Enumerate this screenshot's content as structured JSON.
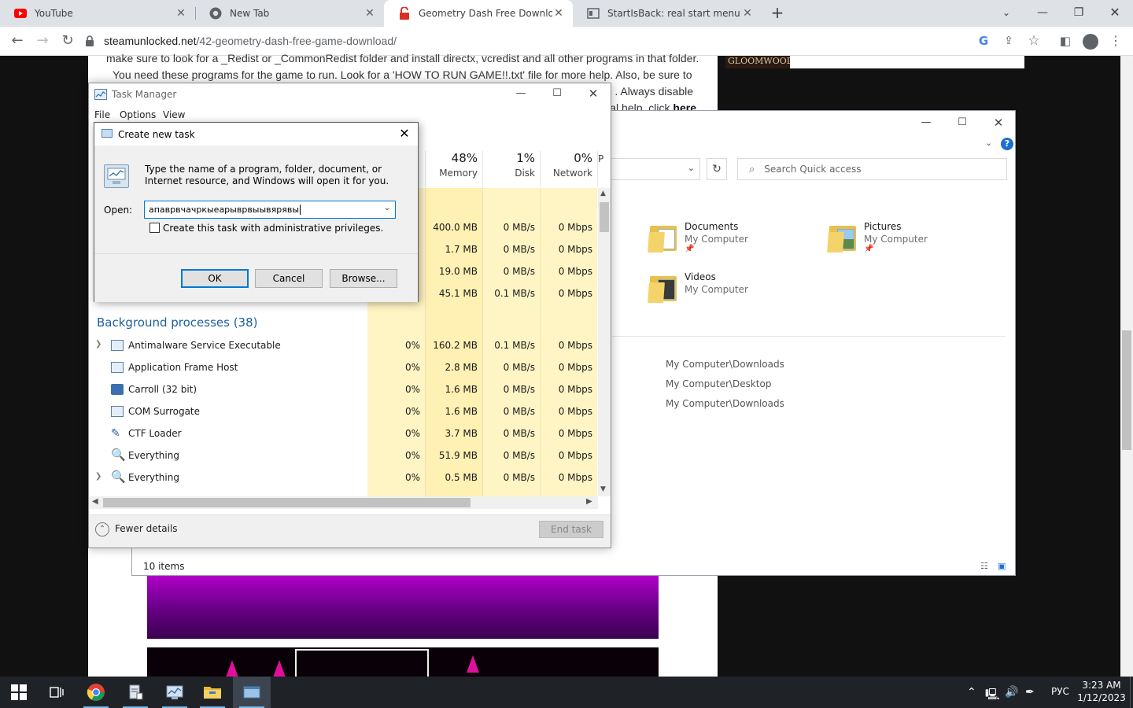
{
  "browser": {
    "tabs": [
      {
        "title": "YouTube",
        "icon": "youtube-icon"
      },
      {
        "title": "New Tab",
        "icon": "chrome-icon"
      },
      {
        "title": "Geometry Dash Free Download (",
        "icon": "steamunlocked-icon",
        "active": true
      },
      {
        "title": "StartIsBack: real start menu for W",
        "icon": "startisback-icon"
      }
    ],
    "url_domain": "steamunlocked.net",
    "url_path": "/42-geometry-dash-free-game-download/"
  },
  "page": {
    "line1": "make sure to look for a _Redist or _CommonRedist folder and install directx, vcredist and all other programs in that folder.",
    "line2": "You need these programs for the game to run. Look for a 'HOW TO RUN GAME!!.txt' file for more help. Also, be sure to",
    "line3_end": ". Always disable",
    "line4_end": "al help, click ",
    "here_link": "here",
    "ad_text": "GLOOMWOOD"
  },
  "explorer": {
    "search_placeholder": "Search Quick access",
    "folders": [
      {
        "name": "Documents",
        "location": "My Computer"
      },
      {
        "name": "Pictures",
        "location": "My Computer"
      },
      {
        "name": "Videos",
        "location": "My Computer"
      }
    ],
    "recent": [
      "My Computer\\Downloads",
      "My Computer\\Desktop",
      "My Computer\\Downloads"
    ],
    "status": "10 items"
  },
  "task_manager": {
    "title": "Task Manager",
    "menu": [
      "File",
      "Options",
      "View"
    ],
    "columns": [
      {
        "pct": "48%",
        "label": "Memory"
      },
      {
        "pct": "1%",
        "label": "Disk"
      },
      {
        "pct": "0%",
        "label": "Network"
      },
      {
        "pct": "",
        "label": "P"
      }
    ],
    "top_rows": [
      {
        "memory": "400.0 MB",
        "disk": "0 MB/s",
        "network": "0 Mbps"
      },
      {
        "memory": "1.7 MB",
        "disk": "0 MB/s",
        "network": "0 Mbps"
      },
      {
        "memory": "19.0 MB",
        "disk": "0 MB/s",
        "network": "0 Mbps"
      },
      {
        "memory": "45.1 MB",
        "disk": "0.1 MB/s",
        "network": "0 Mbps"
      }
    ],
    "section_title": "Background processes (38)",
    "processes": [
      {
        "name": "Antimalware Service Executable",
        "cpu": "0%",
        "memory": "160.2 MB",
        "disk": "0.1 MB/s",
        "network": "0 Mbps",
        "expandable": true
      },
      {
        "name": "Application Frame Host",
        "cpu": "0%",
        "memory": "2.8 MB",
        "disk": "0 MB/s",
        "network": "0 Mbps"
      },
      {
        "name": "Carroll (32 bit)",
        "cpu": "0%",
        "memory": "1.6 MB",
        "disk": "0 MB/s",
        "network": "0 Mbps"
      },
      {
        "name": "COM Surrogate",
        "cpu": "0%",
        "memory": "1.6 MB",
        "disk": "0 MB/s",
        "network": "0 Mbps"
      },
      {
        "name": "CTF Loader",
        "cpu": "0%",
        "memory": "3.7 MB",
        "disk": "0 MB/s",
        "network": "0 Mbps"
      },
      {
        "name": "Everything",
        "cpu": "0%",
        "memory": "51.9 MB",
        "disk": "0 MB/s",
        "network": "0 Mbps"
      },
      {
        "name": "Everything",
        "cpu": "0%",
        "memory": "0.5 MB",
        "disk": "0 MB/s",
        "network": "0 Mbps",
        "expandable": true
      }
    ],
    "fewer_details": "Fewer details",
    "end_task": "End task"
  },
  "run_dialog": {
    "title": "Create new task",
    "description": "Type the name of a program, folder, document, or Internet resource, and Windows will open it for you.",
    "open_label": "Open:",
    "input_value": "апаврвчачркыеарыврвыывярявы",
    "admin_label": "Create this task with administrative privileges.",
    "admin_checked": false,
    "ok": "OK",
    "cancel": "Cancel",
    "browse": "Browse..."
  },
  "taskbar": {
    "language": "РУС",
    "time": "3:23 AM",
    "date": "1/12/2023"
  },
  "colors": {
    "accent": "#0078d7",
    "tm_highlight": "#fff4c4",
    "taskbar": "#1f2328"
  }
}
